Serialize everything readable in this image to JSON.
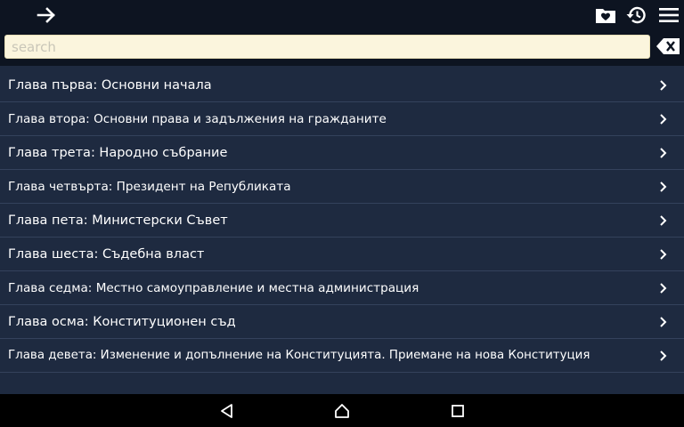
{
  "toolbar": {
    "icons": [
      "arrow-right-icon",
      "favorites-folder-icon",
      "history-icon",
      "menu-icon"
    ]
  },
  "search": {
    "placeholder": "search",
    "value": ""
  },
  "chapters": [
    {
      "label": "Глава първа: Основни начала"
    },
    {
      "label": "Глава втора: Основни права и задължения на гражданите"
    },
    {
      "label": "Глава трета: Народно събрание"
    },
    {
      "label": "Глава четвърта: Президент на Републиката"
    },
    {
      "label": "Глава пета: Министерски Съвет"
    },
    {
      "label": "Глава шеста: Съдебна власт"
    },
    {
      "label": "Глава седма: Местно самоуправление и местна администрация"
    },
    {
      "label": "Глава осма: Конституционен съд"
    },
    {
      "label": "Глава девета: Изменение и допълнение на Конституцията. Приемане на нова Конституция"
    }
  ],
  "navbar": {
    "icons": [
      "back-icon",
      "home-icon",
      "recents-icon"
    ]
  },
  "colors": {
    "toolbar_bg": "#0d1421",
    "list_bg": "#1e2a40",
    "search_bg": "#fbf5dd",
    "text": "#ffffff"
  }
}
